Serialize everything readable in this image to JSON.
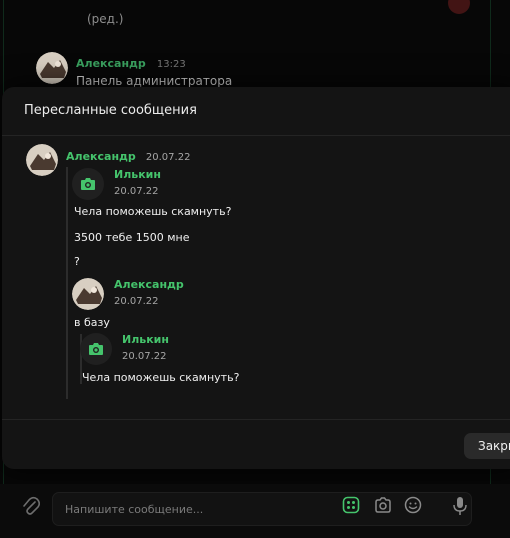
{
  "background_chat": {
    "edited_label": "(ред.)",
    "message": {
      "author": "Александр",
      "time": "13:23",
      "text": "Панель администратора"
    }
  },
  "modal": {
    "title": "Пересланные сообщения",
    "close_label": "Закрыть",
    "forward": {
      "author": "Александр",
      "date": "20.07.22",
      "nested_first": {
        "author": "Илькин",
        "date": "20.07.22",
        "lines": [
          "Чела поможешь скамнуть?",
          "3500 тебе 1500 мне",
          "?"
        ]
      },
      "nested_second": {
        "author": "Александр",
        "date": "20.07.22",
        "text": "в базу",
        "inner": {
          "author": "Илькин",
          "date": "20.07.22",
          "text": "Чела поможешь скамнуть?"
        }
      }
    }
  },
  "input_bar": {
    "placeholder": "Напишите сообщение..."
  },
  "colors": {
    "accent_green": "#45c46c",
    "modal_bg": "#141414",
    "page_bg": "#070707"
  },
  "icons": [
    "camera-icon",
    "paperclip-icon",
    "sticker-icon",
    "photo-icon",
    "emoji-icon",
    "microphone-icon"
  ]
}
